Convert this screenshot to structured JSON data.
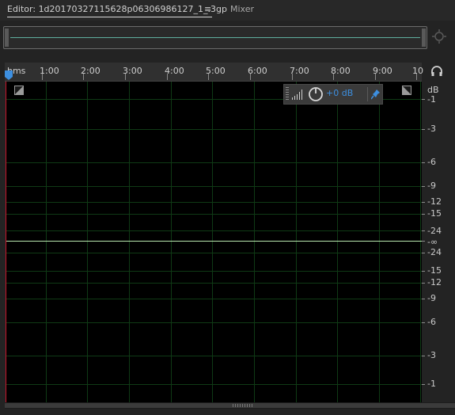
{
  "tabs": {
    "editor_label": "Editor: 1d20170327115628p06306986127_1_.3gp",
    "menu_glyph": "≡",
    "mixer_label": "Mixer"
  },
  "ruler": {
    "unit": "hms",
    "ticks": [
      "1:00",
      "2:00",
      "3:00",
      "4:00",
      "5:00",
      "6:00",
      "7:00",
      "8:00",
      "9:00",
      "10"
    ]
  },
  "hud": {
    "volume_label": "+0 dB",
    "icons": [
      "level-bars-icon",
      "volume-knob-icon",
      "pin-icon"
    ]
  },
  "db_scale": {
    "header": "dB",
    "labels": [
      "-1",
      "-3",
      "-6",
      "-9",
      "-12",
      "-15",
      "-24",
      "-∞",
      "-24",
      "-15",
      "-12",
      "-9",
      "-6",
      "-3",
      "-1"
    ]
  },
  "colors": {
    "waveform_line": "#b9e9b0",
    "grid": "#0f3a15",
    "playhead": "#c8152b",
    "accent": "#3d8fe0"
  }
}
